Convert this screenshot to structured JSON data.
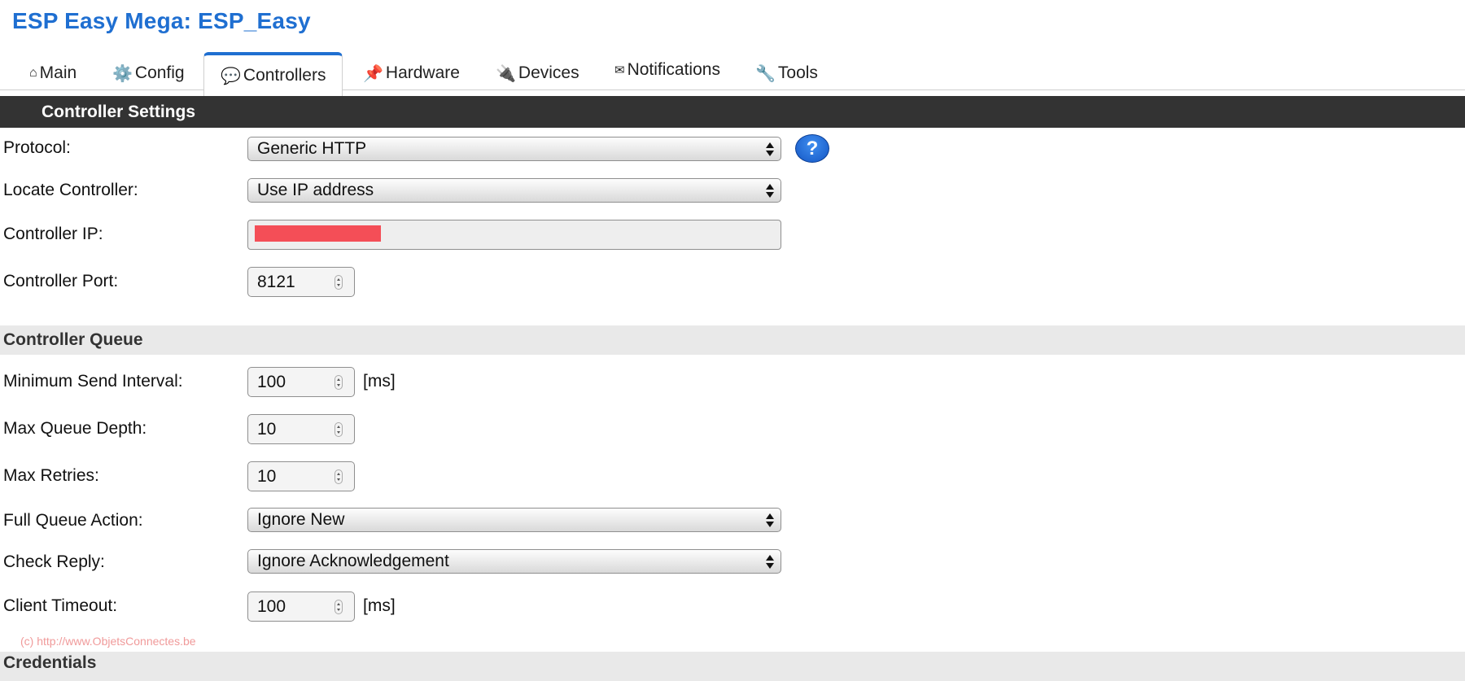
{
  "app": {
    "title": "ESP Easy Mega: ESP_Easy"
  },
  "tabs": [
    {
      "label": "Main",
      "icon": "home-icon",
      "glyph": "⌂"
    },
    {
      "label": "Config",
      "icon": "gear-icon",
      "glyph": "⚙️"
    },
    {
      "label": "Controllers",
      "icon": "speech-bubble-icon",
      "glyph": "💬",
      "active": true
    },
    {
      "label": "Hardware",
      "icon": "pushpin-icon",
      "glyph": "📌"
    },
    {
      "label": "Devices",
      "icon": "plug-icon",
      "glyph": "🔌"
    },
    {
      "label": "Notifications",
      "icon": "envelope-icon",
      "glyph": "✉"
    },
    {
      "label": "Tools",
      "icon": "wrench-icon",
      "glyph": "🔧"
    }
  ],
  "controller_settings": {
    "heading": "Controller Settings",
    "protocol": {
      "label": "Protocol:",
      "value": "Generic HTTP",
      "help": "?"
    },
    "locate": {
      "label": "Locate Controller:",
      "value": "Use IP address"
    },
    "ip": {
      "label": "Controller IP:",
      "value": ""
    },
    "port": {
      "label": "Controller Port:",
      "value": "8121"
    }
  },
  "controller_queue": {
    "heading": "Controller Queue",
    "min_send_interval": {
      "label": "Minimum Send Interval:",
      "value": "100",
      "unit": "[ms]"
    },
    "max_queue_depth": {
      "label": "Max Queue Depth:",
      "value": "10"
    },
    "max_retries": {
      "label": "Max Retries:",
      "value": "10"
    },
    "full_queue_action": {
      "label": "Full Queue Action:",
      "value": "Ignore New"
    },
    "check_reply": {
      "label": "Check Reply:",
      "value": "Ignore Acknowledgement"
    },
    "client_timeout": {
      "label": "Client Timeout:",
      "value": "100",
      "unit": "[ms]"
    }
  },
  "credentials": {
    "heading": "Credentials"
  },
  "watermark": "(c) http://www.ObjetsConnectes.be",
  "colors": {
    "accent": "#1f6fd1",
    "header_bar": "#333333",
    "section_bar": "#e9e9e9",
    "redaction": "#f44e57"
  }
}
